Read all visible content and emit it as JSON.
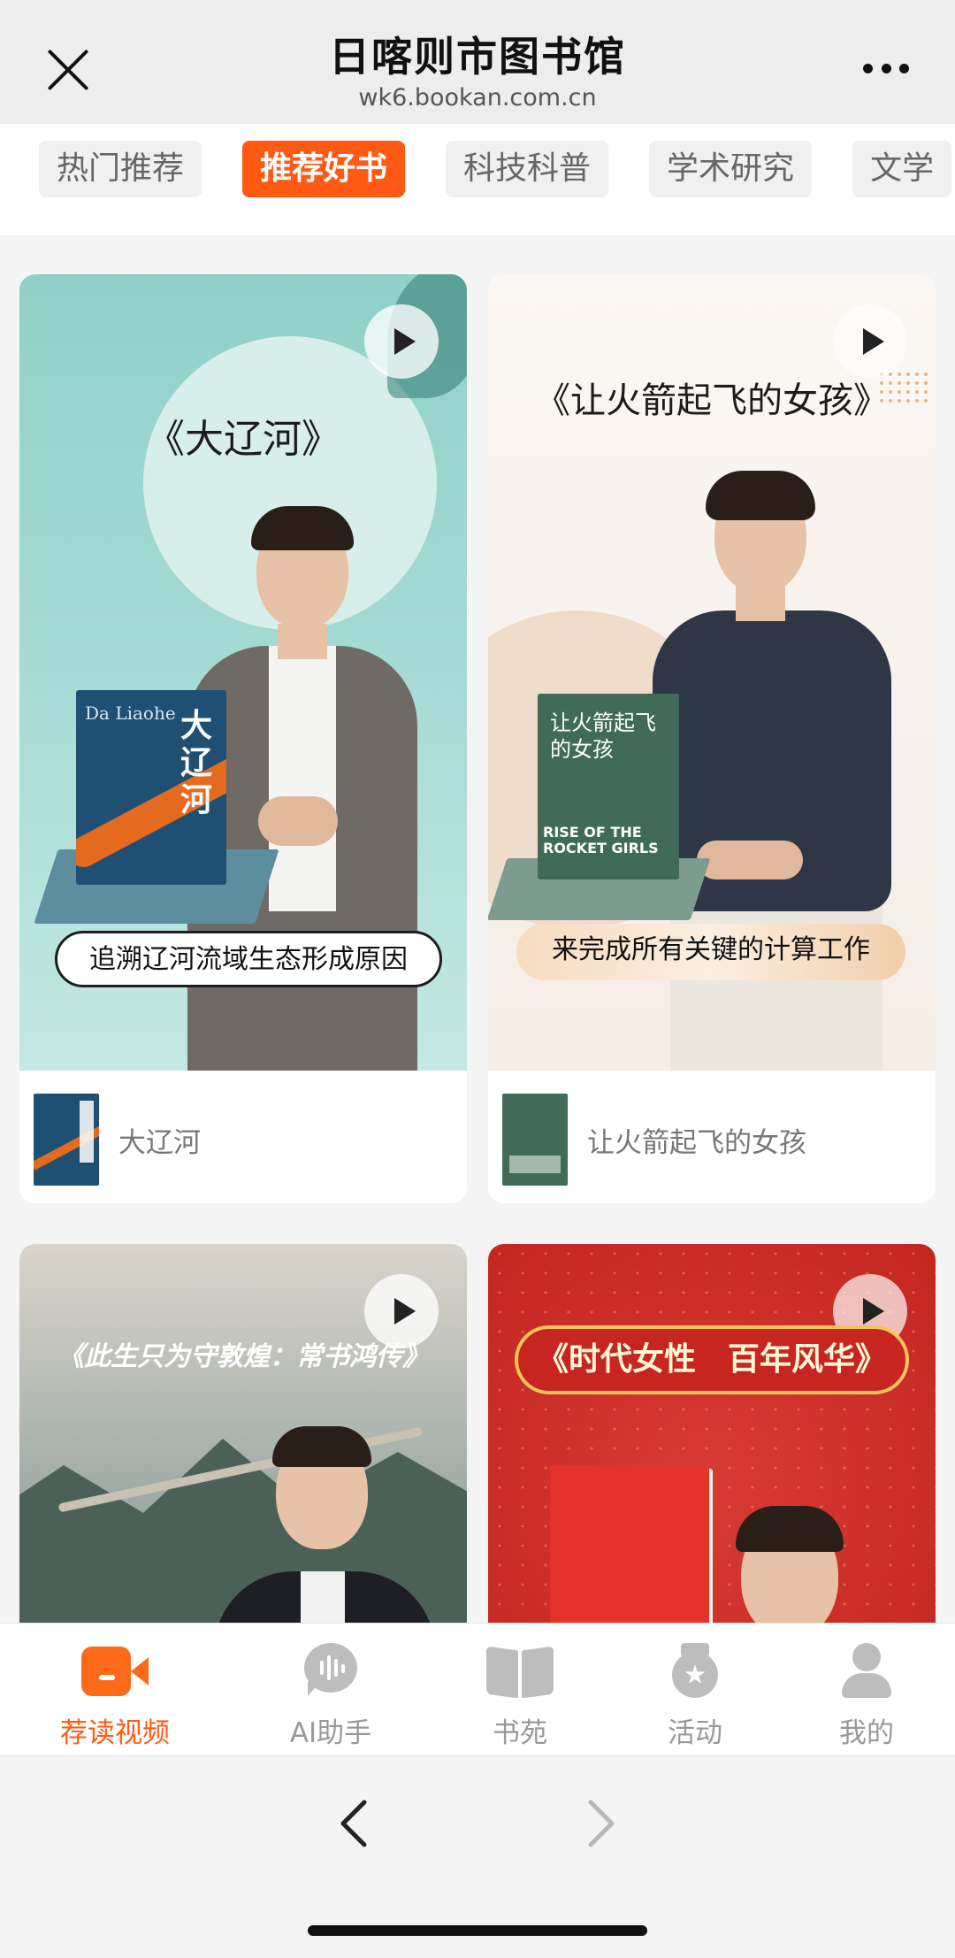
{
  "header": {
    "title": "日喀则市图书馆",
    "url": "wk6.bookan.com.cn"
  },
  "tabs": [
    {
      "label": "热门推荐",
      "active": false
    },
    {
      "label": "推荐好书",
      "active": true
    },
    {
      "label": "科技科普",
      "active": false
    },
    {
      "label": "学术研究",
      "active": false
    },
    {
      "label": "文学",
      "active": false
    }
  ],
  "cards": [
    {
      "cover_title": "《大辽河》",
      "caption": "追溯辽河流域生态形成原因",
      "book_title": "大辽河",
      "book_cover_text": "Da Liaohe",
      "book_vertical_text": "大辽河"
    },
    {
      "cover_title": "《让火箭起飞的女孩》",
      "caption": "来完成所有关键的计算工作",
      "book_title": "让火箭起飞的女孩",
      "book_cover_text": "RISE OF THE ROCKET GIRLS",
      "book_vertical_text": "让火箭起飞的女孩"
    },
    {
      "cover_title": "《此生只为守敦煌：常书鸿传》"
    },
    {
      "cover_title": "《时代女性　百年风华》"
    }
  ],
  "bottom_nav": [
    {
      "label": "荐读视频",
      "icon": "video-camera-icon",
      "active": true
    },
    {
      "label": "AI助手",
      "icon": "ai-voice-icon",
      "active": false
    },
    {
      "label": "书苑",
      "icon": "open-book-icon",
      "active": false
    },
    {
      "label": "活动",
      "icon": "medal-icon",
      "active": false
    },
    {
      "label": "我的",
      "icon": "user-icon",
      "active": false
    }
  ],
  "colors": {
    "accent": "#ff5a14",
    "inactive": "#999999"
  }
}
